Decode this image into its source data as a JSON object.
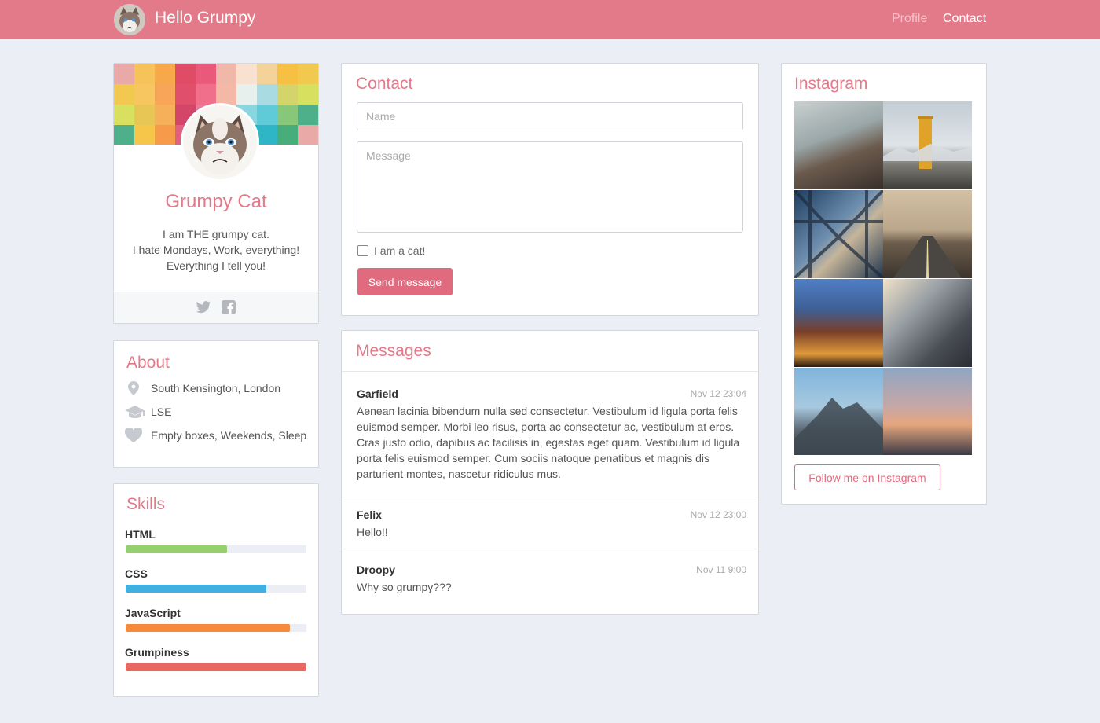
{
  "navbar": {
    "title": "Hello Grumpy",
    "links": [
      "Profile",
      "Contact"
    ],
    "accent": "#e37a8a"
  },
  "profile": {
    "name": "Grumpy Cat",
    "bio": [
      "I am THE grumpy cat.",
      "I hate Mondays, Work, everything!",
      "Everything I tell you!"
    ],
    "social_icons": [
      "twitter-icon",
      "facebook-icon"
    ]
  },
  "about": {
    "title": "About",
    "items": [
      {
        "icon": "map-pin-icon",
        "text": "South Kensington, London"
      },
      {
        "icon": "graduation-cap-icon",
        "text": "LSE"
      },
      {
        "icon": "heart-icon",
        "text": "Empty boxes, Weekends, Sleep"
      }
    ]
  },
  "skills": {
    "title": "Skills",
    "items": [
      {
        "label": "HTML",
        "level": 0.56,
        "color": "#95cf6e"
      },
      {
        "label": "CSS",
        "level": 0.78,
        "color": "#3fb0e0"
      },
      {
        "label": "JavaScript",
        "level": 0.91,
        "color": "#f58a3c"
      },
      {
        "label": "Grumpiness",
        "level": 1.0,
        "color": "#e8675f"
      }
    ]
  },
  "contact": {
    "title": "Contact",
    "name_placeholder": "Name",
    "message_placeholder": "Message",
    "checkbox_label": "I am a cat!",
    "send_label": "Send message"
  },
  "messages": {
    "title": "Messages",
    "items": [
      {
        "author": "Garfield",
        "time": "Nov 12 23:04",
        "body": "Aenean lacinia bibendum nulla sed consectetur. Vestibulum id ligula porta felis euismod semper. Morbi leo risus, porta ac consectetur ac, vestibulum at eros. Cras justo odio, dapibus ac facilisis in, egestas eget quam. Vestibulum id ligula porta felis euismod semper. Cum sociis natoque penatibus et magnis dis parturient montes, nascetur ridiculus mus."
      },
      {
        "author": "Felix",
        "time": "Nov 12 23:00",
        "body": "Hello!!"
      },
      {
        "author": "Droopy",
        "time": "Nov 11 9:00",
        "body": "Why so grumpy???"
      }
    ]
  },
  "instagram": {
    "title": "Instagram",
    "follow_label": "Follow me on Instagram",
    "photos": [
      "coast-photo",
      "tower-photo",
      "bridge-photo",
      "road-photo",
      "building-photo",
      "street-photo",
      "mountain-photo",
      "sunset-photo"
    ]
  }
}
